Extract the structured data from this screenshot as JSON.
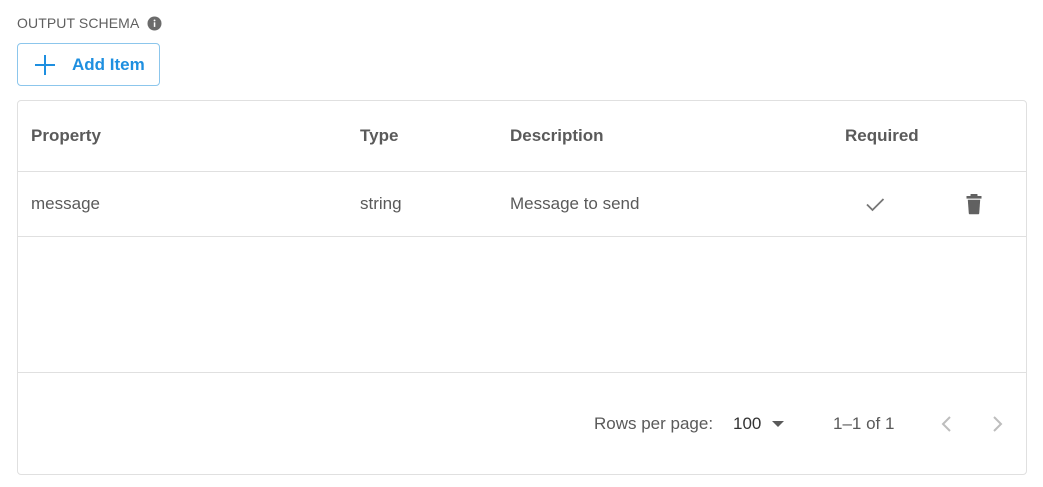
{
  "section": {
    "title": "OUTPUT SCHEMA",
    "info_icon": "info-icon"
  },
  "toolbar": {
    "add_item_label": "Add Item",
    "add_icon": "plus-icon"
  },
  "table": {
    "columns": [
      "Property",
      "Type",
      "Description",
      "Required"
    ],
    "rows": [
      {
        "property": "message",
        "type": "string",
        "description": "Message to send",
        "required": true,
        "required_icon": "check-icon",
        "delete_icon": "trash-icon"
      }
    ]
  },
  "pagination": {
    "rows_per_page_label": "Rows per page:",
    "rows_per_page_value": "100",
    "range_label": "1–1 of 1",
    "prev_icon": "chevron-left-icon",
    "next_icon": "chevron-right-icon"
  },
  "colors": {
    "accent": "#1e8fe0",
    "border_accent": "#8cc6ec",
    "divider": "#e0e0e0",
    "text_muted": "#5a5a5a",
    "icon_gray": "#616161",
    "disabled_gray": "#bdbdbd"
  }
}
